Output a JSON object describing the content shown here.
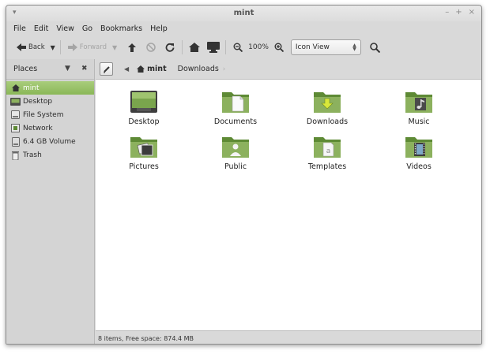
{
  "window": {
    "title": "mint",
    "controls": [
      "–",
      "+",
      "×"
    ]
  },
  "menubar": [
    "File",
    "Edit",
    "View",
    "Go",
    "Bookmarks",
    "Help"
  ],
  "toolbar": {
    "back_label": "Back",
    "forward_label": "Forward",
    "zoom_level": "100%",
    "view_mode": "Icon View"
  },
  "sidebar": {
    "title": "Places",
    "items": [
      {
        "label": "mint",
        "icon": "home-icon",
        "selected": true
      },
      {
        "label": "Desktop",
        "icon": "desktop-icon"
      },
      {
        "label": "File System",
        "icon": "drive-icon"
      },
      {
        "label": "Network",
        "icon": "network-icon"
      },
      {
        "label": "6.4 GB Volume",
        "icon": "volume-icon"
      },
      {
        "label": "Trash",
        "icon": "trash-icon"
      }
    ]
  },
  "pathbar": {
    "crumbs": [
      "mint",
      "Downloads"
    ]
  },
  "files": [
    {
      "label": "Desktop",
      "emblem": "desktop"
    },
    {
      "label": "Documents",
      "emblem": "document"
    },
    {
      "label": "Downloads",
      "emblem": "download"
    },
    {
      "label": "Music",
      "emblem": "music"
    },
    {
      "label": "Pictures",
      "emblem": "pictures"
    },
    {
      "label": "Public",
      "emblem": "person"
    },
    {
      "label": "Templates",
      "emblem": "template"
    },
    {
      "label": "Videos",
      "emblem": "film"
    }
  ],
  "status": "8 items, Free space: 874.4 MB",
  "colors": {
    "folder": "#8cb15e",
    "folder_dark": "#5e8a35",
    "selection": "#9bc46a"
  }
}
